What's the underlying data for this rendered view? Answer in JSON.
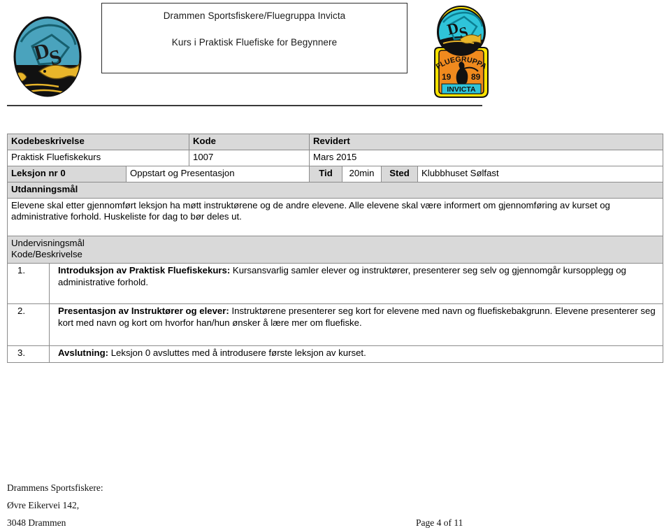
{
  "document": {
    "title_box": {
      "line1": "Drammen Sportsfiskere/Fluegruppa Invicta",
      "line2": "Kurs i Praktisk Fluefiske for Begynnere"
    },
    "logos": {
      "left_name": "drammen-sportsfiskere-logo",
      "left_text": "DS",
      "right_name": "fluegruppa-invicta-badge",
      "right_text_top": "DS",
      "right_text_arc": "FLUEGRUPPA",
      "right_year_left": "19",
      "right_year_right": "89",
      "right_banner": "INVICTA"
    },
    "table": {
      "row_meta_headers": {
        "kodebeskrivelse": "Kodebeskrivelse",
        "kode": "Kode",
        "revidert": "Revidert"
      },
      "row_meta_values": {
        "kodebeskrivelse": "Praktisk Fluefiskekurs",
        "kode": "1007",
        "revidert": "Mars 2015"
      },
      "row_lesson": {
        "leksjon": "Leksjon nr 0",
        "navn": "Oppstart og Presentasjon",
        "tid_label": "Tid",
        "tid_value": "20min",
        "sted_label": "Sted",
        "sted_value": "Klubbhuset Sølfast"
      },
      "utdanningsmal": {
        "heading": "Utdanningsmål",
        "text": "Elevene skal etter gjennomført leksjon ha møtt instruktørene og de andre elevene. Alle elevene skal være informert om gjennomføring av kurset og administrative forhold. Huskeliste for dag to bør deles ut."
      },
      "undervisningsmal": {
        "line1": "Undervisningsmål",
        "line2": "Kode/Beskrivelse"
      },
      "items": [
        {
          "num": "1.",
          "bold": "Introduksjon av Praktisk Fluefiskekurs:",
          "text": " Kursansvarlig samler elever og instruktører, presenterer seg selv og gjennomgår kursopplegg og administrative forhold."
        },
        {
          "num": "2.",
          "bold": "Presentasjon av Instruktører og elever:",
          "text": " Instruktørene presenterer seg kort for elevene med navn og fluefiskebakgrunn. Elevene presenterer seg kort med navn og kort om hvorfor han/hun ønsker å lære mer om fluefiske."
        },
        {
          "num": "3.",
          "bold": "Avslutning:",
          "text": " Leksjon 0 avsluttes med å introdusere første leksjon av kurset."
        }
      ]
    },
    "footer": {
      "line1": "Drammens Sportsfiskere:",
      "line2": "Øvre Eikervei 142,",
      "line3": "3048 Drammen",
      "page": "Page 4 of 11"
    },
    "colors": {
      "shading": "#d9d9d9",
      "border": "#8c8c8c",
      "logo_teal": "#4aa3bd",
      "logo_teal_bright": "#2fc4d9",
      "logo_black": "#111111",
      "logo_gold": "#e8b52a",
      "logo_orange": "#f08a1e",
      "logo_yellow": "#ffe400"
    }
  }
}
